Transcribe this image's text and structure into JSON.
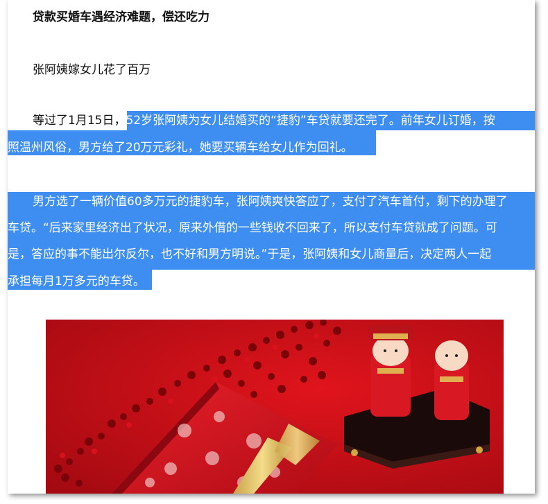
{
  "heading": "贷款买婚车遇经济难题，偿还吃力",
  "subheading": "张阿姨嫁女儿花了百万",
  "paragraph1": {
    "line1_plain": "等过了1月15日，",
    "line1_selected": "52岁张阿姨为女儿结婚买的“捷豹”车贷就要还完了。前年女儿订婚，按",
    "line2_selected": "照温州风俗，男方给了20万元彩礼，她要买辆车给女儿作为回礼。"
  },
  "paragraph2": {
    "line1": "男方选了一辆价值60多万元的捷豹车，张阿姨爽快答应了，支付了汽车首付，剩下的办理了",
    "line2": "车贷。“后来家里经济出了状况，原来外借的一些钱收不回来了，所以支付车贷就成了问题。可",
    "line3": "是，答应的事不能出尔反尔，也不好和男方明说。”于是，张阿姨和女儿商量后，决定两人一起",
    "line4": "承担每月1万多元的车贷。"
  },
  "colors": {
    "selection": "#3d8ef0",
    "photo_background": "#c8101a"
  }
}
